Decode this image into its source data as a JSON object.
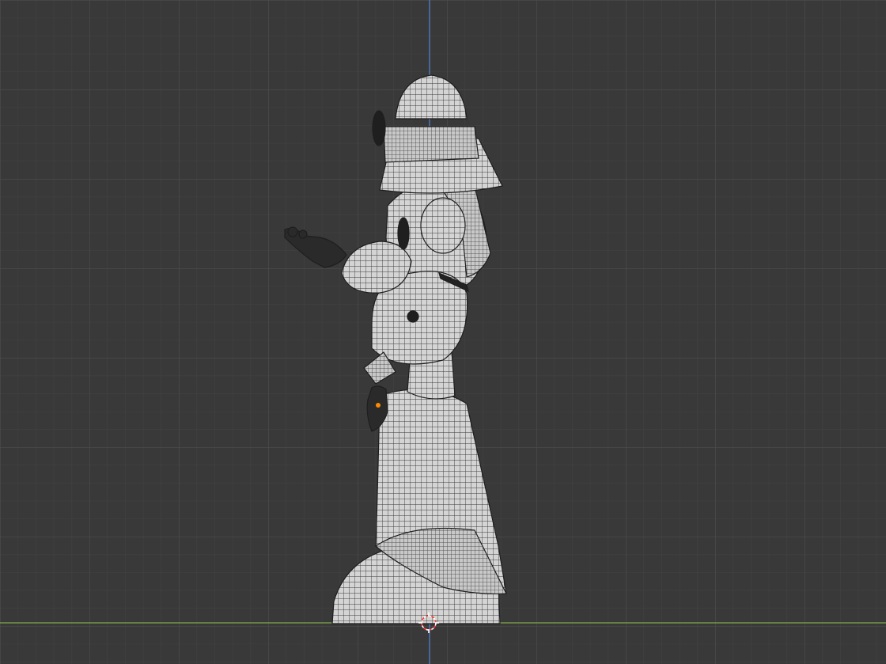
{
  "viewport": {
    "background": "#393939",
    "grid_minor_color": "#434343",
    "grid_major_color": "#4d4d4d",
    "axis_z_color": "#4f7fc9",
    "axis_y_color": "#7fa84a",
    "cursor_colors": [
      "#ff3b30",
      "#ffffff"
    ],
    "model_fill": "#cfcfcf",
    "wire_color": "#2b2b2b",
    "selection_dot_color": "#ff8a00"
  },
  "icons": {
    "3d_cursor": "3d-cursor-icon"
  }
}
